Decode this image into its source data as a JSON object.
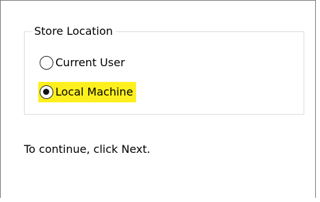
{
  "store_location": {
    "title": "Store Location",
    "options": [
      {
        "label": "Current User",
        "selected": false
      },
      {
        "label": "Local Machine",
        "selected": true
      }
    ],
    "highlight_color": "#fdf01e"
  },
  "instruction_text": "To continue, click Next."
}
